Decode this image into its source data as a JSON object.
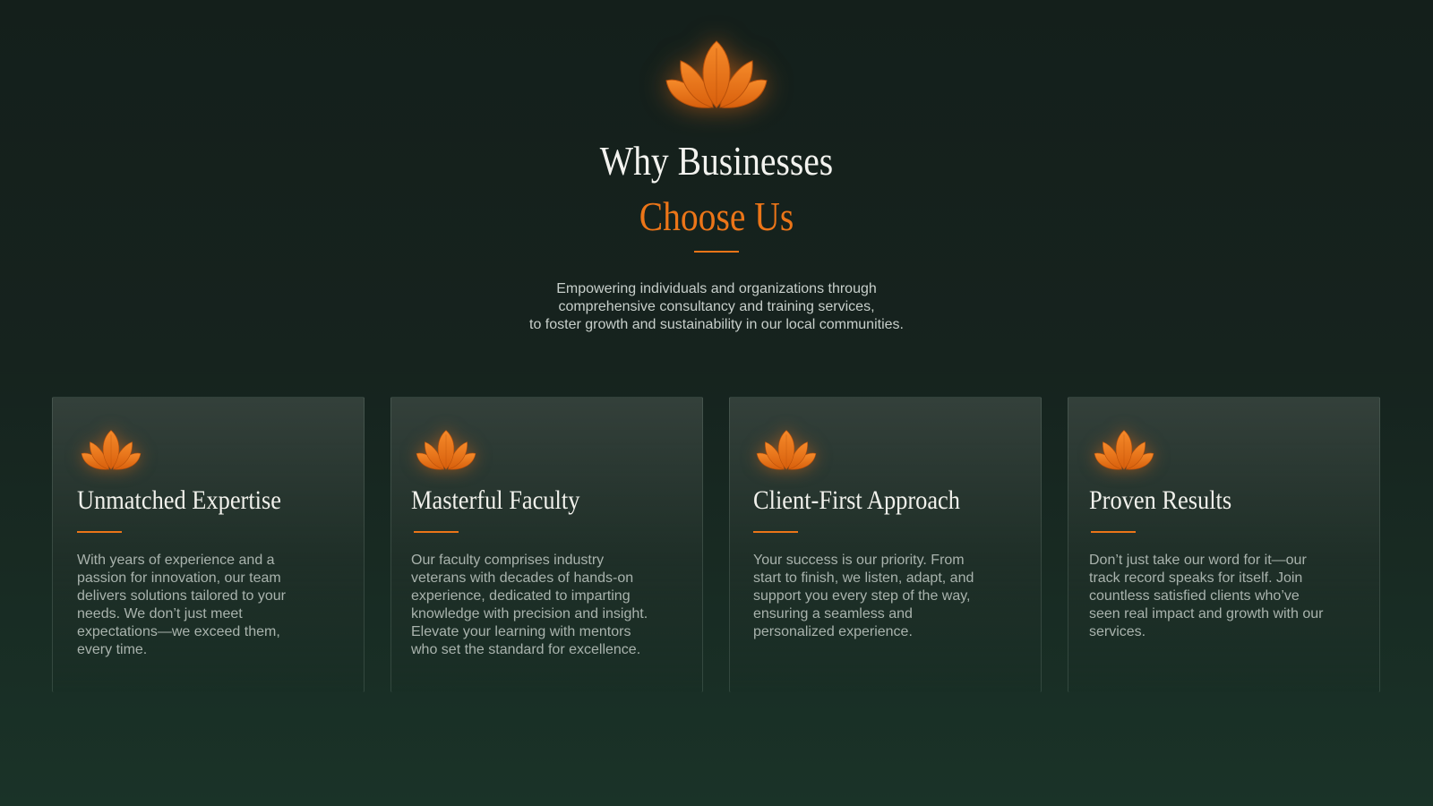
{
  "header": {
    "title_line1": "Why Businesses",
    "title_line2": "Choose Us",
    "subtitle_lines": [
      "Empowering individuals and organizations through",
      "comprehensive consultancy and training services,",
      "to foster growth and sustainability in our local communities."
    ],
    "icon": "lotus-icon"
  },
  "colors": {
    "accent": "#ec7518",
    "background": "#16231e",
    "heading": "#f3f3ef",
    "body_text": "#a9b3ad"
  },
  "cards": [
    {
      "title": "Unmatched Expertise",
      "icon": "lotus-icon",
      "lines": [
        "With years of experience and a",
        "passion for innovation, our team",
        "delivers solutions tailored to your",
        "needs. We don’t just meet",
        "expectations—we exceed them,",
        "every time."
      ]
    },
    {
      "title": "Masterful Faculty",
      "icon": "lotus-icon",
      "lines": [
        "Our faculty comprises industry",
        "veterans with decades of hands-on",
        "experience, dedicated to imparting",
        "knowledge with precision and insight.",
        "Elevate your learning with mentors",
        "who set the standard for excellence."
      ]
    },
    {
      "title": "Client-First Approach",
      "icon": "lotus-icon",
      "lines": [
        "Your success is our priority. From",
        "start to finish, we listen, adapt, and",
        "support you every step of the way,",
        "ensuring a seamless and",
        "personalized experience."
      ]
    },
    {
      "title": "Proven Results",
      "icon": "lotus-icon",
      "lines": [
        "Don’t just take our word for it—our",
        "track record speaks for itself. Join",
        "countless satisfied clients who’ve",
        "seen real impact and growth with our",
        "services."
      ]
    }
  ]
}
